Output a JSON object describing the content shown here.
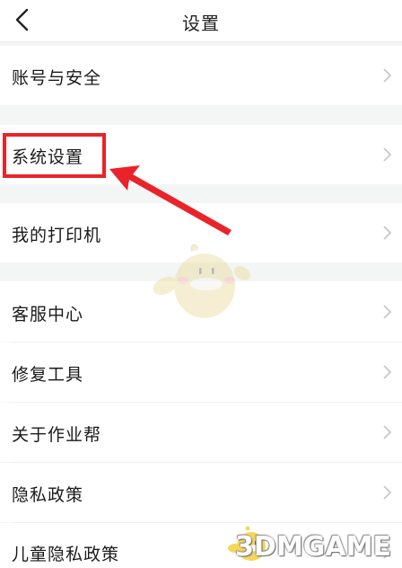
{
  "header": {
    "title": "设置"
  },
  "menu": {
    "account_security": "账号与安全",
    "system_settings": "系统设置",
    "my_printer": "我的打印机",
    "customer_center": "客服中心",
    "repair_tool": "修复工具",
    "about": "关于作业帮",
    "privacy_policy": "隐私政策",
    "child_privacy_policy": "儿童隐私政策"
  },
  "icons": {
    "back": "chevron-left-icon",
    "row_arrow": "chevron-right-icon"
  },
  "colors": {
    "highlight": "#e8242a",
    "chevron": "#c8c8c8",
    "section_gap": "#f4f6f5"
  },
  "watermark": {
    "text": "3DMGAME"
  }
}
